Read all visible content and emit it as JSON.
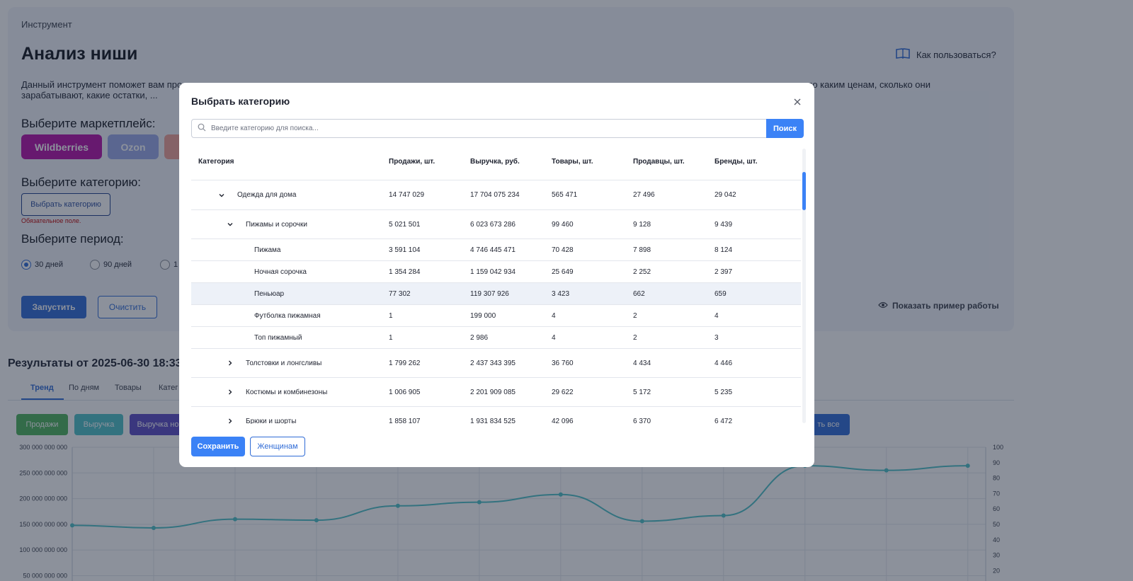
{
  "page": {
    "breadcrumb": "Инструмент",
    "title": "Анализ ниши",
    "how_to": "Как пользоваться?",
    "description_line1": "Данный инструмент поможет вам про",
    "description_line1_tail": "количестве, по каким ценам, сколько они",
    "description_line2": "зарабатывают, какие остатки, ...",
    "marketplace_heading": "Выберите маркетплейс:",
    "marketplaces": [
      {
        "label": "Wildberries",
        "color": "#b40fa7"
      },
      {
        "label": "Ozon",
        "color": "#9aa8e8"
      },
      {
        "label": "",
        "color": "#f0a196"
      }
    ],
    "category_heading": "Выберите категорию:",
    "category_button": "Выбрать категорию",
    "required_note": "Обязательное поле.",
    "period_heading": "Выберите период:",
    "periods": [
      {
        "label": "30 дней",
        "selected": true
      },
      {
        "label": "90 дней",
        "selected": false
      },
      {
        "label": "1",
        "selected": false
      }
    ],
    "run_button": "Запустить",
    "clear_button": "Очистить",
    "example_link": "Показать пример работы"
  },
  "results": {
    "heading": "Результаты от 2025-06-30 18:33",
    "tabs": [
      "Тренд",
      "По дням",
      "Товары",
      "Катег"
    ],
    "metric_buttons": [
      {
        "label": "Продажи",
        "color": "#4cb35a"
      },
      {
        "label": "Выручка",
        "color": "#4cc1c7"
      },
      {
        "label": "Выручка но",
        "color": "#5a4bc4"
      },
      {
        "label": "ть все",
        "color": "#2f6bd6"
      }
    ]
  },
  "chart_data": {
    "type": "line",
    "left_axis_ticks": [
      "300 000 000 000",
      "250 000 000 000",
      "200 000 000 000",
      "150 000 000 000",
      "100 000 000 000",
      "50 000 000 000"
    ],
    "left_axis_values": [
      300000000000,
      250000000000,
      200000000000,
      150000000000,
      100000000000,
      50000000000
    ],
    "right_axis_ticks": [
      "100",
      "90",
      "80",
      "70",
      "60",
      "50",
      "40",
      "30",
      "20"
    ],
    "right_axis_values": [
      100,
      90,
      80,
      70,
      60,
      50,
      40,
      30,
      20
    ],
    "ylim": [
      0,
      300000000000
    ],
    "series": [
      {
        "color": "#4cc1c7",
        "values": [
          148000000000,
          143000000000,
          160000000000,
          158000000000,
          186000000000,
          193000000000,
          208000000000,
          156000000000,
          167000000000,
          264000000000,
          255000000000,
          264000000000
        ]
      }
    ],
    "grid": true
  },
  "modal": {
    "title": "Выбрать категорию",
    "search_placeholder": "Введите категорию для поиска...",
    "search_button": "Поиск",
    "columns": [
      "Категория",
      "Продажи, шт.",
      "Выручка, руб.",
      "Товары, шт.",
      "Продавцы, шт.",
      "Бренды, шт."
    ],
    "rows": [
      {
        "name": "Одежда для дома",
        "level": 0,
        "toggle": "expanded",
        "sales": "14 747 029",
        "revenue": "17 704 075 234",
        "goods": "565 471",
        "sellers": "27 496",
        "brands": "29 042"
      },
      {
        "name": "Пижамы и сорочки",
        "level": 1,
        "toggle": "expanded",
        "sales": "5 021 501",
        "revenue": "6 023 673 286",
        "goods": "99 460",
        "sellers": "9 128",
        "brands": "9 439"
      },
      {
        "name": "Пижама",
        "level": 2,
        "toggle": "none",
        "sales": "3 591 104",
        "revenue": "4 746 445 471",
        "goods": "70 428",
        "sellers": "7 898",
        "brands": "8 124"
      },
      {
        "name": "Ночная сорочка",
        "level": 2,
        "toggle": "none",
        "sales": "1 354 284",
        "revenue": "1 159 042 934",
        "goods": "25 649",
        "sellers": "2 252",
        "brands": "2 397"
      },
      {
        "name": "Пеньюар",
        "level": 2,
        "toggle": "none",
        "highlight": true,
        "sales": "77 302",
        "revenue": "119 307 926",
        "goods": "3 423",
        "sellers": "662",
        "brands": "659"
      },
      {
        "name": "Футболка пижамная",
        "level": 2,
        "toggle": "none",
        "sales": "1",
        "revenue": "199 000",
        "goods": "4",
        "sellers": "2",
        "brands": "4"
      },
      {
        "name": "Топ пижамный",
        "level": 2,
        "toggle": "none",
        "sales": "1",
        "revenue": "2 986",
        "goods": "4",
        "sellers": "2",
        "brands": "3"
      },
      {
        "name": "Толстовки и лонгсливы",
        "level": 1,
        "toggle": "collapsed",
        "sales": "1 799 262",
        "revenue": "2 437 343 395",
        "goods": "36 760",
        "sellers": "4 434",
        "brands": "4 446"
      },
      {
        "name": "Костюмы и комбинезоны",
        "level": 1,
        "toggle": "collapsed",
        "sales": "1 006 905",
        "revenue": "2 201 909 085",
        "goods": "29 622",
        "sellers": "5 172",
        "brands": "5 235"
      },
      {
        "name": "Брюки и шорты",
        "level": 1,
        "toggle": "collapsed",
        "sales": "1 858 107",
        "revenue": "1 931 834 525",
        "goods": "42 096",
        "sellers": "6 370",
        "brands": "6 472"
      }
    ],
    "save_button": "Сохранить",
    "selected_chip": "Женщинам"
  }
}
